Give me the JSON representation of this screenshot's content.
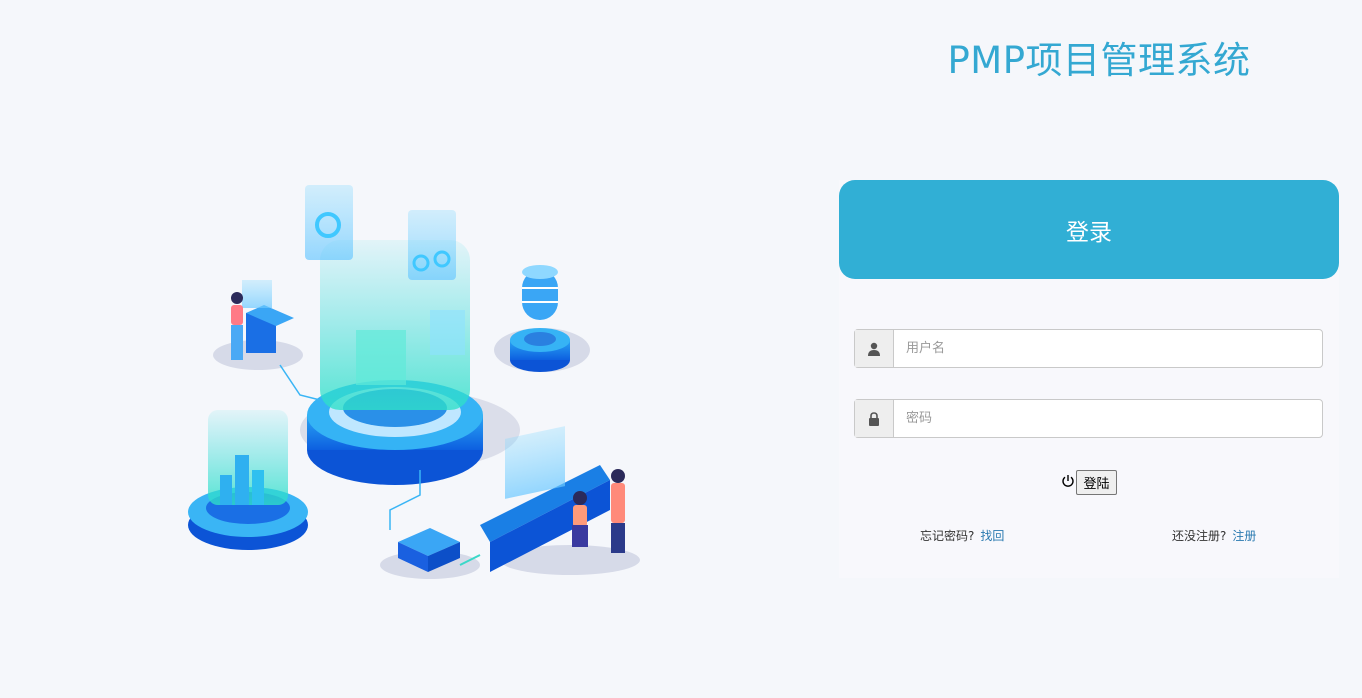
{
  "page": {
    "title": "PMP项目管理系统"
  },
  "login_card": {
    "header": "登录",
    "username": {
      "placeholder": "用户名",
      "value": "",
      "icon": "user-icon"
    },
    "password": {
      "placeholder": "密码",
      "value": "",
      "icon": "lock-icon"
    },
    "submit": {
      "label": "登陆",
      "icon": "power-icon"
    },
    "forgot": {
      "text": "忘记密码?",
      "link": "找回"
    },
    "register": {
      "text": "还没注册?",
      "link": "注册"
    }
  },
  "colors": {
    "accent": "#31afd5",
    "title": "#34a8d2",
    "background": "#f5f7fb",
    "link": "#2a7ab0"
  }
}
